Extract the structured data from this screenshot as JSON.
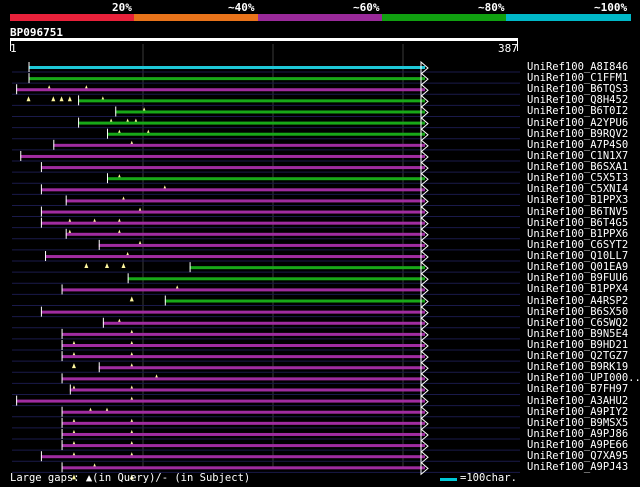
{
  "legend": {
    "segments": [
      {
        "color": "#e8213a"
      },
      {
        "color": "#e8731a"
      },
      {
        "color": "#9a2a9a"
      },
      {
        "color": "#10a010"
      },
      {
        "color": "#00b8c8"
      }
    ],
    "labels": [
      "20%",
      "~40%",
      "~60%",
      "~80%",
      "~100%"
    ]
  },
  "query": {
    "name": "BP096751",
    "start": "1",
    "end": "387"
  },
  "colors": {
    "purple": "#a02ca0",
    "green": "#18a818",
    "cyan": "#1ec8d8",
    "gap": "#fff8a0"
  },
  "hits": [
    {
      "name": "UniRef100_A8I846",
      "color": "cyan",
      "start": 0.04,
      "end": 1.0,
      "gaps": []
    },
    {
      "name": "UniRef100_C1FFM1",
      "color": "green",
      "start": 0.04,
      "end": 1.0,
      "gaps": [
        0.09,
        0.18
      ]
    },
    {
      "name": "UniRef100_B6TQS3",
      "color": "purple",
      "start": 0.01,
      "end": 1.0,
      "gaps": [
        0.04,
        0.1,
        0.12,
        0.14,
        0.22
      ]
    },
    {
      "name": "UniRef100_Q8H452",
      "color": "green",
      "start": 0.16,
      "end": 1.0,
      "gaps": [
        0.32
      ]
    },
    {
      "name": "UniRef100_B6T0I2",
      "color": "green",
      "start": 0.25,
      "end": 1.0,
      "gaps": [
        0.24,
        0.28,
        0.3
      ]
    },
    {
      "name": "UniRef100_A2YPU6",
      "color": "green",
      "start": 0.16,
      "end": 1.0,
      "gaps": [
        0.26,
        0.33
      ]
    },
    {
      "name": "UniRef100_B9RQV2",
      "color": "green",
      "start": 0.23,
      "end": 1.0,
      "gaps": [
        0.29
      ]
    },
    {
      "name": "UniRef100_A7P4S0",
      "color": "purple",
      "start": 0.1,
      "end": 1.0,
      "gaps": []
    },
    {
      "name": "UniRef100_C1N1X7",
      "color": "purple",
      "start": 0.02,
      "end": 1.0,
      "gaps": []
    },
    {
      "name": "UniRef100_B6SXA1",
      "color": "purple",
      "start": 0.07,
      "end": 1.0,
      "gaps": [
        0.26
      ]
    },
    {
      "name": "UniRef100_C5X5I3",
      "color": "green",
      "start": 0.23,
      "end": 1.0,
      "gaps": [
        0.37
      ]
    },
    {
      "name": "UniRef100_C5XNI4",
      "color": "purple",
      "start": 0.07,
      "end": 1.0,
      "gaps": [
        0.27
      ]
    },
    {
      "name": "UniRef100_B1PPX3",
      "color": "purple",
      "start": 0.13,
      "end": 1.0,
      "gaps": [
        0.31
      ]
    },
    {
      "name": "UniRef100_B6TNV5",
      "color": "purple",
      "start": 0.07,
      "end": 1.0,
      "gaps": [
        0.14,
        0.2,
        0.26
      ]
    },
    {
      "name": "UniRef100_B6T4G5",
      "color": "purple",
      "start": 0.07,
      "end": 1.0,
      "gaps": [
        0.14,
        0.26
      ]
    },
    {
      "name": "UniRef100_B1PPX6",
      "color": "purple",
      "start": 0.13,
      "end": 1.0,
      "gaps": [
        0.31
      ]
    },
    {
      "name": "UniRef100_C6SYT2",
      "color": "purple",
      "start": 0.21,
      "end": 1.0,
      "gaps": [
        0.28
      ]
    },
    {
      "name": "UniRef100_Q10LL7",
      "color": "purple",
      "start": 0.08,
      "end": 1.0,
      "gaps": [
        0.18,
        0.23,
        0.27
      ]
    },
    {
      "name": "UniRef100_Q01EA9",
      "color": "green",
      "start": 0.43,
      "end": 1.0,
      "gaps": []
    },
    {
      "name": "UniRef100_B9FUU6",
      "color": "green",
      "start": 0.28,
      "end": 1.0,
      "gaps": [
        0.4
      ]
    },
    {
      "name": "UniRef100_B1PPX4",
      "color": "purple",
      "start": 0.12,
      "end": 1.0,
      "gaps": [
        0.29
      ]
    },
    {
      "name": "UniRef100_A4RSP2",
      "color": "green",
      "start": 0.37,
      "end": 1.0,
      "gaps": []
    },
    {
      "name": "UniRef100_B6SX50",
      "color": "purple",
      "start": 0.07,
      "end": 1.0,
      "gaps": [
        0.26
      ]
    },
    {
      "name": "UniRef100_C6SWQ2",
      "color": "purple",
      "start": 0.22,
      "end": 1.0,
      "gaps": [
        0.29
      ]
    },
    {
      "name": "UniRef100_B9N5E4",
      "color": "purple",
      "start": 0.12,
      "end": 1.0,
      "gaps": [
        0.15,
        0.29
      ]
    },
    {
      "name": "UniRef100_B9HD21",
      "color": "purple",
      "start": 0.12,
      "end": 1.0,
      "gaps": [
        0.15,
        0.29
      ]
    },
    {
      "name": "UniRef100_Q2TGZ7",
      "color": "purple",
      "start": 0.12,
      "end": 1.0,
      "gaps": [
        0.15,
        0.29
      ]
    },
    {
      "name": "UniRef100_B9RK19",
      "color": "purple",
      "start": 0.21,
      "end": 1.0,
      "gaps": [
        0.35
      ]
    },
    {
      "name": "UniRef100_UPI000..",
      "color": "purple",
      "start": 0.12,
      "end": 1.0,
      "gaps": [
        0.15,
        0.29
      ]
    },
    {
      "name": "UniRef100_B7FH97",
      "color": "purple",
      "start": 0.14,
      "end": 1.0,
      "gaps": [
        0.29
      ]
    },
    {
      "name": "UniRef100_A3AHU2",
      "color": "purple",
      "start": 0.01,
      "end": 1.0,
      "gaps": [
        0.19,
        0.23
      ]
    },
    {
      "name": "UniRef100_A9PIY2",
      "color": "purple",
      "start": 0.12,
      "end": 1.0,
      "gaps": [
        0.15,
        0.29
      ]
    },
    {
      "name": "UniRef100_B9MSX5",
      "color": "purple",
      "start": 0.12,
      "end": 1.0,
      "gaps": [
        0.15,
        0.29
      ]
    },
    {
      "name": "UniRef100_A9PJ86",
      "color": "purple",
      "start": 0.12,
      "end": 1.0,
      "gaps": [
        0.15,
        0.29
      ]
    },
    {
      "name": "UniRef100_A9PE66",
      "color": "purple",
      "start": 0.12,
      "end": 1.0,
      "gaps": [
        0.15,
        0.29
      ]
    },
    {
      "name": "UniRef100_Q7XA95",
      "color": "purple",
      "start": 0.07,
      "end": 1.0,
      "gaps": [
        0.2
      ]
    },
    {
      "name": "UniRef100_A9PJ43",
      "color": "purple",
      "start": 0.12,
      "end": 1.0,
      "gaps": [
        0.15,
        0.29
      ]
    }
  ],
  "footer": {
    "gaps_text": "Large gaps: ▲(in Query)/- (in Subject)",
    "scale_text": "=100char."
  }
}
